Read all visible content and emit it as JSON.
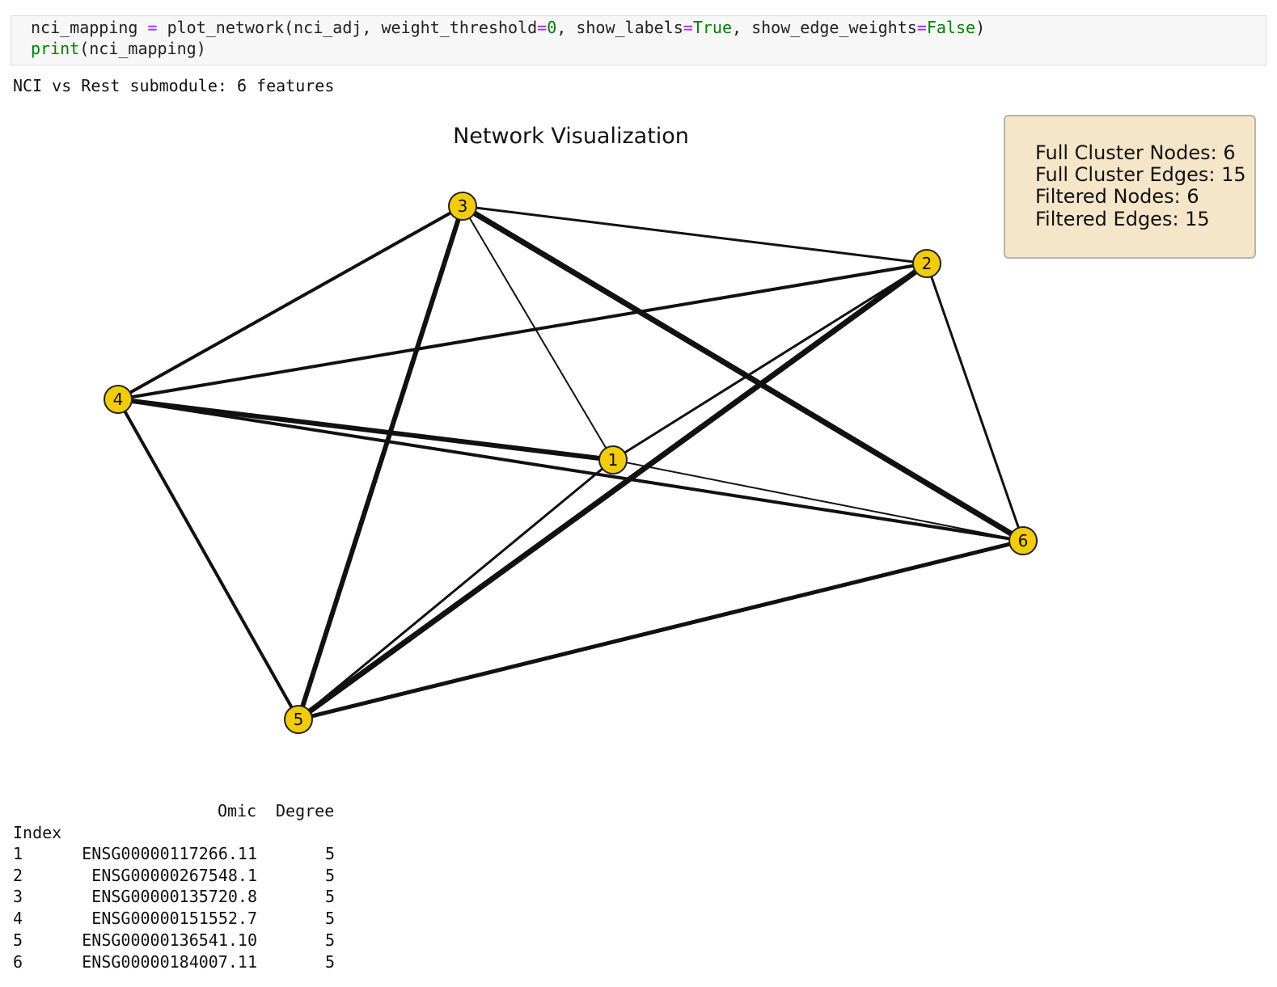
{
  "code": {
    "line1": {
      "var": "nci_mapping ",
      "eq": "=",
      "call_open": " plot_network(nci_adj, weight_threshold",
      "eq2": "=",
      "zero": "0",
      "mid1": ", show_labels",
      "eq3": "=",
      "true_kw": "True",
      "mid2": ", show_edge_weights",
      "eq4": "=",
      "false_kw": "False",
      "close": ")"
    },
    "line2": {
      "fn": "print",
      "args": "(nci_mapping)"
    }
  },
  "output": {
    "header_line": "NCI vs Rest submodule: 6 features"
  },
  "colors": {
    "node_fill": "#f2cc0c",
    "node_stroke": "#222222",
    "edge": "#111111",
    "legend_bg": "#f5e6c9",
    "legend_border": "#b9b3a6"
  },
  "network": {
    "title": "Network Visualization",
    "nodes": [
      {
        "id": "1",
        "label": "1"
      },
      {
        "id": "2",
        "label": "2"
      },
      {
        "id": "3",
        "label": "3"
      },
      {
        "id": "4",
        "label": "4"
      },
      {
        "id": "5",
        "label": "5"
      },
      {
        "id": "6",
        "label": "6"
      }
    ],
    "edges": [
      {
        "source": "3",
        "target": "2",
        "weight": 3
      },
      {
        "source": "3",
        "target": "4",
        "weight": 4
      },
      {
        "source": "3",
        "target": "5",
        "weight": 6
      },
      {
        "source": "3",
        "target": "1",
        "weight": 2
      },
      {
        "source": "3",
        "target": "6",
        "weight": 7
      },
      {
        "source": "4",
        "target": "2",
        "weight": 4
      },
      {
        "source": "4",
        "target": "1",
        "weight": 6
      },
      {
        "source": "4",
        "target": "6",
        "weight": 4
      },
      {
        "source": "4",
        "target": "5",
        "weight": 4
      },
      {
        "source": "1",
        "target": "2",
        "weight": 3
      },
      {
        "source": "1",
        "target": "6",
        "weight": 2
      },
      {
        "source": "1",
        "target": "5",
        "weight": 3
      },
      {
        "source": "2",
        "target": "6",
        "weight": 3
      },
      {
        "source": "2",
        "target": "5",
        "weight": 7
      },
      {
        "source": "6",
        "target": "5",
        "weight": 5
      }
    ],
    "stats": [
      "Full Cluster Nodes: 6",
      "Full Cluster Edges: 15",
      "Filtered Nodes: 6",
      "Filtered Edges: 15"
    ]
  },
  "table": {
    "col_omic": "Omic",
    "col_degree": "Degree",
    "index_label": "Index",
    "rows": [
      {
        "index": "1",
        "omic": "ENSG00000117266.11",
        "degree": "5"
      },
      {
        "index": "2",
        "omic": "ENSG00000267548.1",
        "degree": "5"
      },
      {
        "index": "3",
        "omic": "ENSG00000135720.8",
        "degree": "5"
      },
      {
        "index": "4",
        "omic": "ENSG00000151552.7",
        "degree": "5"
      },
      {
        "index": "5",
        "omic": "ENSG00000136541.10",
        "degree": "5"
      },
      {
        "index": "6",
        "omic": "ENSG00000184007.11",
        "degree": "5"
      }
    ]
  }
}
